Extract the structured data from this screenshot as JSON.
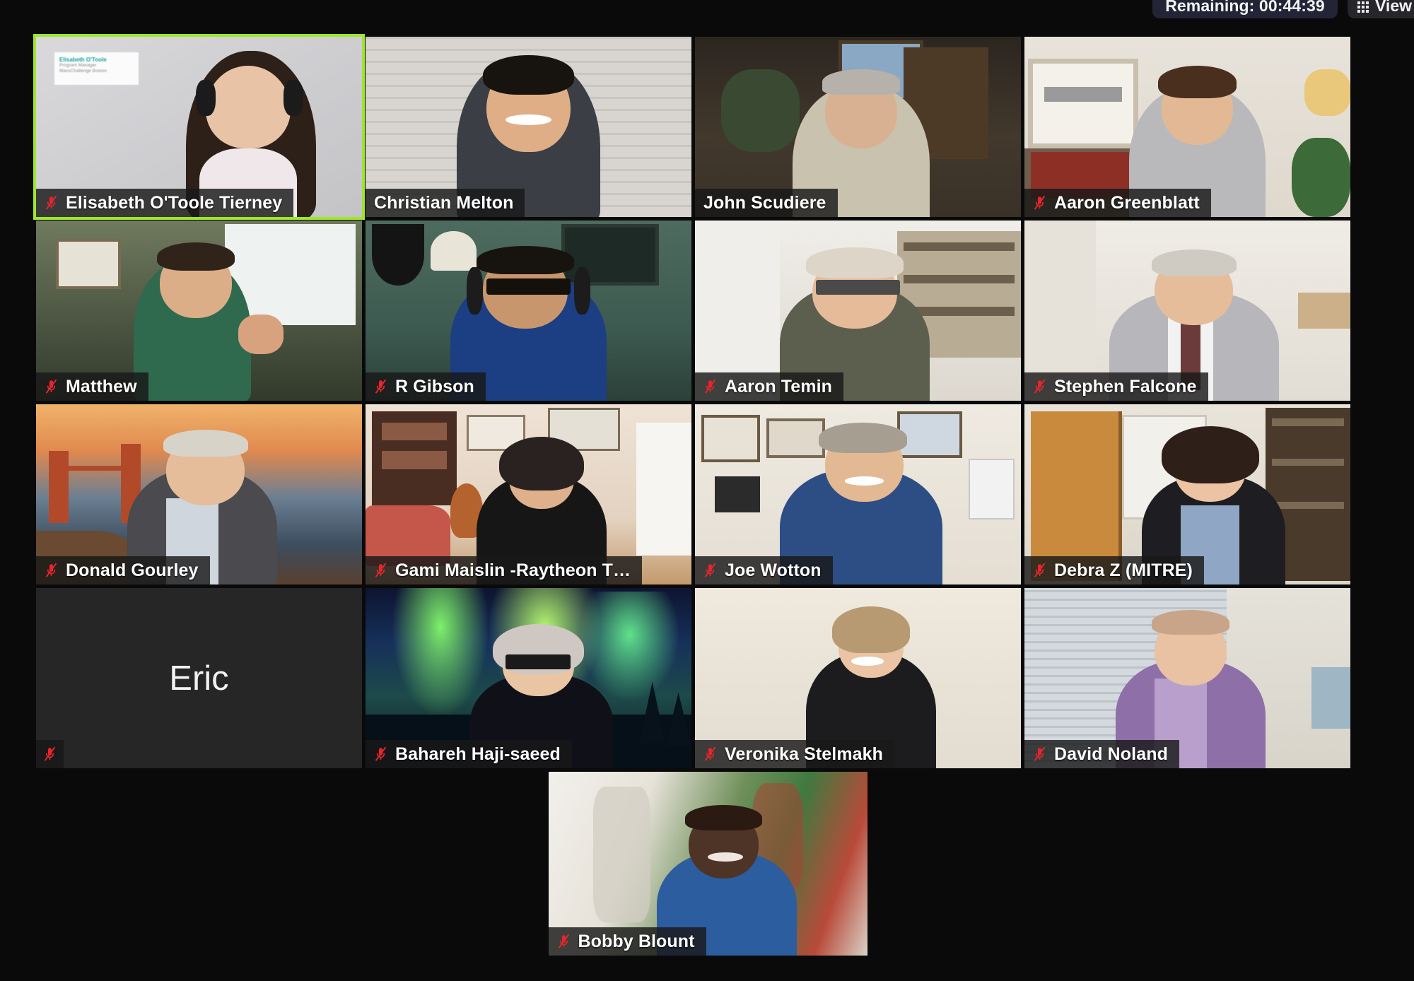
{
  "app": "zoom-gallery-view",
  "topbar": {
    "remaining_label": "Remaining: 00:44:39",
    "view_label": "View",
    "view_icon": "grid-icon"
  },
  "self_name_card": {
    "name": "Elisabeth O'Toole",
    "title": "Program Manager",
    "org": "MassChallenge Boston"
  },
  "gallery": {
    "columns": 4,
    "rows": 5,
    "mute_icon": "microphone-muted-icon",
    "active_speaker_color": "#9ee62a",
    "background_color": "#0a0a0a",
    "participants": [
      {
        "name": "Elisabeth O'Toole Tierney",
        "muted": true,
        "active_speaker": true,
        "video": true
      },
      {
        "name": "Christian Melton",
        "muted": false,
        "active_speaker": false,
        "video": true
      },
      {
        "name": "John Scudiere",
        "muted": false,
        "active_speaker": false,
        "video": true
      },
      {
        "name": "Aaron Greenblatt",
        "muted": true,
        "active_speaker": false,
        "video": true
      },
      {
        "name": "Matthew",
        "muted": true,
        "active_speaker": false,
        "video": true
      },
      {
        "name": "R Gibson",
        "muted": true,
        "active_speaker": false,
        "video": true
      },
      {
        "name": "Aaron Temin",
        "muted": true,
        "active_speaker": false,
        "video": true
      },
      {
        "name": "Stephen Falcone",
        "muted": true,
        "active_speaker": false,
        "video": true
      },
      {
        "name": "Donald Gourley",
        "muted": true,
        "active_speaker": false,
        "video": true
      },
      {
        "name": "Gami Maislin -Raytheon T…",
        "muted": true,
        "active_speaker": false,
        "video": true
      },
      {
        "name": "Joe Wotton",
        "muted": true,
        "active_speaker": false,
        "video": true
      },
      {
        "name": "Debra Z (MITRE)",
        "muted": true,
        "active_speaker": false,
        "video": true
      },
      {
        "name": "Eric",
        "muted": true,
        "active_speaker": false,
        "video": false
      },
      {
        "name": "Bahareh Haji-saeed",
        "muted": true,
        "active_speaker": false,
        "video": true
      },
      {
        "name": "Veronika Stelmakh",
        "muted": true,
        "active_speaker": false,
        "video": true
      },
      {
        "name": "David Noland",
        "muted": true,
        "active_speaker": false,
        "video": true
      },
      {
        "name": "Bobby Blount",
        "muted": true,
        "active_speaker": false,
        "video": true
      }
    ]
  }
}
